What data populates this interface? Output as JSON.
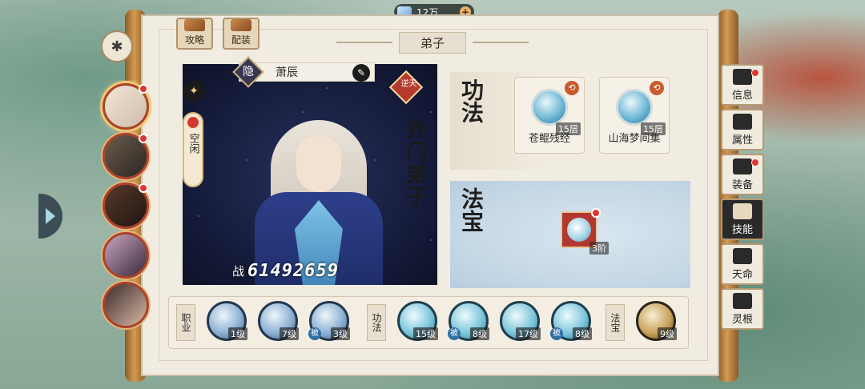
{
  "currency": {
    "amount": "12万",
    "plus": "+"
  },
  "top_tabs": [
    {
      "label": "攻略"
    },
    {
      "label": "配装"
    }
  ],
  "title": "弟子",
  "disciple": {
    "hide_tag": "隐",
    "name": "萧辰",
    "edit_icon": "✎",
    "rank_tag": "逆天",
    "role": "外门弟子",
    "status": "空闲",
    "power_label": "战",
    "power_value": "61492659"
  },
  "gongfa": {
    "label": "功法",
    "skills": [
      {
        "name": "苍鲲残经",
        "level": "15层",
        "badge": "⟲"
      },
      {
        "name": "山海梦间集",
        "level": "15层",
        "badge": "⟲"
      }
    ]
  },
  "fabao": {
    "label": "法宝",
    "level": "3阶"
  },
  "bottom": {
    "cat_job": "职业",
    "cat_gongfa": "功法",
    "cat_fabao": "法宝",
    "job_slots": [
      {
        "level": "1级",
        "pass": ""
      },
      {
        "level": "7级",
        "pass": ""
      },
      {
        "level": "3级",
        "pass": "被"
      }
    ],
    "gongfa_slots": [
      {
        "level": "15级",
        "pass": ""
      },
      {
        "level": "8级",
        "pass": "被"
      },
      {
        "level": "17级",
        "pass": ""
      },
      {
        "level": "8级",
        "pass": "被"
      }
    ],
    "fabao_slots": [
      {
        "level": "9级",
        "pass": ""
      }
    ]
  },
  "right_nav": [
    {
      "label": "信息",
      "icon": "info-icon",
      "dot": true,
      "active": false
    },
    {
      "label": "属性",
      "icon": "attributes-icon",
      "dot": false,
      "active": false
    },
    {
      "label": "装备",
      "icon": "equipment-icon",
      "dot": true,
      "active": false
    },
    {
      "label": "技能",
      "icon": "skills-icon",
      "dot": false,
      "active": true
    },
    {
      "label": "天命",
      "icon": "destiny-icon",
      "dot": false,
      "active": false
    },
    {
      "label": "灵根",
      "icon": "spirit-root-icon",
      "dot": false,
      "active": false
    }
  ],
  "colors": {
    "accent_red": "#e0342c",
    "frame_brown": "#b2936a",
    "paper": "#f1ece2"
  }
}
